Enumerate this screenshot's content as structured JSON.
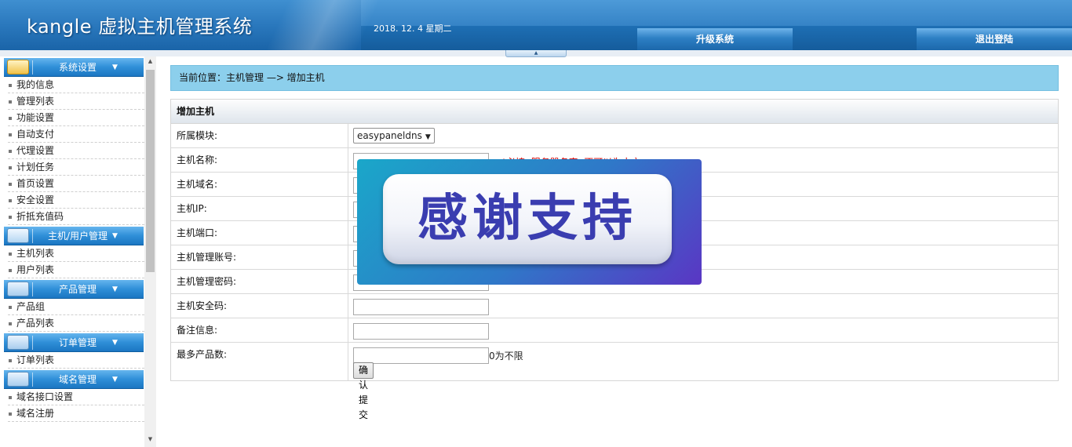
{
  "header": {
    "logo": "kangle 虚拟主机管理系统",
    "date": "2018. 12. 4  星期二",
    "buttons": {
      "upgrade": "升级系统",
      "logout": "退出登陆"
    },
    "toggle_glyph": "▲"
  },
  "sidebar": {
    "groups": [
      {
        "title": "系统设置",
        "icon": "book-icon",
        "arrow": "▼",
        "items": [
          "我的信息",
          "管理列表",
          "功能设置",
          "自动支付",
          "代理设置",
          "计划任务",
          "首页设置",
          "安全设置",
          "折抵充值码"
        ]
      },
      {
        "title": "主机/用户管理",
        "icon": "users-icon",
        "arrow": "▼",
        "items": [
          "主机列表",
          "用户列表"
        ]
      },
      {
        "title": "产品管理",
        "icon": "computer-icon",
        "arrow": "▼",
        "items": [
          "产品组",
          "产品列表"
        ]
      },
      {
        "title": "订单管理",
        "icon": "computer-icon",
        "arrow": "▼",
        "items": [
          "订单列表"
        ]
      },
      {
        "title": "域名管理",
        "icon": "computer-icon",
        "arrow": "▼",
        "items": [
          "域名接口设置",
          "域名注册"
        ]
      }
    ],
    "scroll": {
      "up": "▲",
      "down": "▼"
    }
  },
  "breadcrumb": "当前位置：主机管理 —> 增加主机",
  "form": {
    "title": "增加主机",
    "rows": [
      {
        "label": "所属模块:",
        "type": "select",
        "value": "easypaneldns"
      },
      {
        "label": "主机名称:",
        "type": "text",
        "value": "",
        "hint": "*必填, 服务器名字, 不可以为中文"
      },
      {
        "label": "主机域名:",
        "type": "text",
        "value": ""
      },
      {
        "label": "主机IP:",
        "type": "text",
        "value": ""
      },
      {
        "label": "主机端口:",
        "type": "text",
        "value": ""
      },
      {
        "label": "主机管理账号:",
        "type": "text",
        "value": ""
      },
      {
        "label": "主机管理密码:",
        "type": "text",
        "value": ""
      },
      {
        "label": "主机安全码:",
        "type": "text",
        "value": ""
      },
      {
        "label": "备注信息:",
        "type": "text",
        "value": ""
      },
      {
        "label": "最多产品数:",
        "type": "text",
        "value": "",
        "hint": "0为不限"
      }
    ],
    "submit_label": "确认提交"
  },
  "overlay": {
    "text": "感谢支持"
  },
  "colors": {
    "header_blue": "#2a78bd",
    "breadcrumb_bg": "#8ccfec",
    "hint_red": "#d40000",
    "overlay_text": "#3a3db0"
  }
}
